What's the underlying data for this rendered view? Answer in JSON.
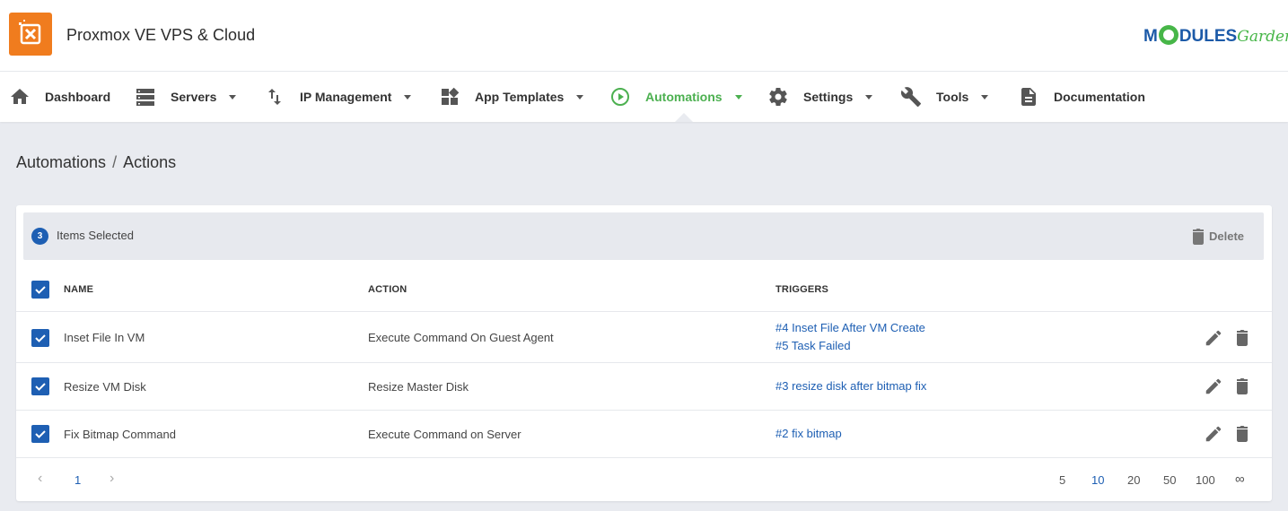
{
  "header": {
    "app_title": "Proxmox VE VPS & Cloud",
    "brand_part1": "M",
    "brand_part2": "DULES",
    "brand_part3": "Garden",
    "accent_color": "#4cb050",
    "logo_color": "#f07c1e",
    "logo_icon": "close-box-icon"
  },
  "nav": {
    "items": [
      {
        "label": "Dashboard",
        "icon": "home-icon"
      },
      {
        "label": "Servers",
        "icon": "servers-icon"
      },
      {
        "label": "IP Management",
        "icon": "swap-vertical-icon"
      },
      {
        "label": "App Templates",
        "icon": "widgets-icon"
      },
      {
        "label": "Automations",
        "icon": "play-circle-icon",
        "active": true
      },
      {
        "label": "Settings",
        "icon": "gear-icon"
      },
      {
        "label": "Tools",
        "icon": "wrench-icon"
      },
      {
        "label": "Documentation",
        "icon": "document-icon"
      }
    ]
  },
  "breadcrumb": {
    "parent": "Automations",
    "separator": "/",
    "current": "Actions"
  },
  "selection": {
    "count": "3",
    "label": "Items Selected",
    "delete_label": "Delete"
  },
  "table": {
    "columns": [
      "NAME",
      "ACTION",
      "TRIGGERS"
    ],
    "rows": [
      {
        "name": "Inset File In VM",
        "action": "Execute Command On Guest Agent",
        "triggers": [
          "#4 Inset File After VM Create",
          "#5 Task Failed"
        ],
        "checked": true
      },
      {
        "name": "Resize VM Disk",
        "action": "Resize Master Disk",
        "triggers": [
          "#3 resize disk after bitmap fix"
        ],
        "checked": true
      },
      {
        "name": "Fix Bitmap Command",
        "action": "Execute Command on Server",
        "triggers": [
          "#2 fix bitmap"
        ],
        "checked": true
      }
    ]
  },
  "pagination": {
    "prev": "‹",
    "current_page": "1",
    "next": "›",
    "page_sizes": [
      "5",
      "10",
      "20",
      "50",
      "100",
      "∞"
    ],
    "selected_page_size": "10"
  }
}
